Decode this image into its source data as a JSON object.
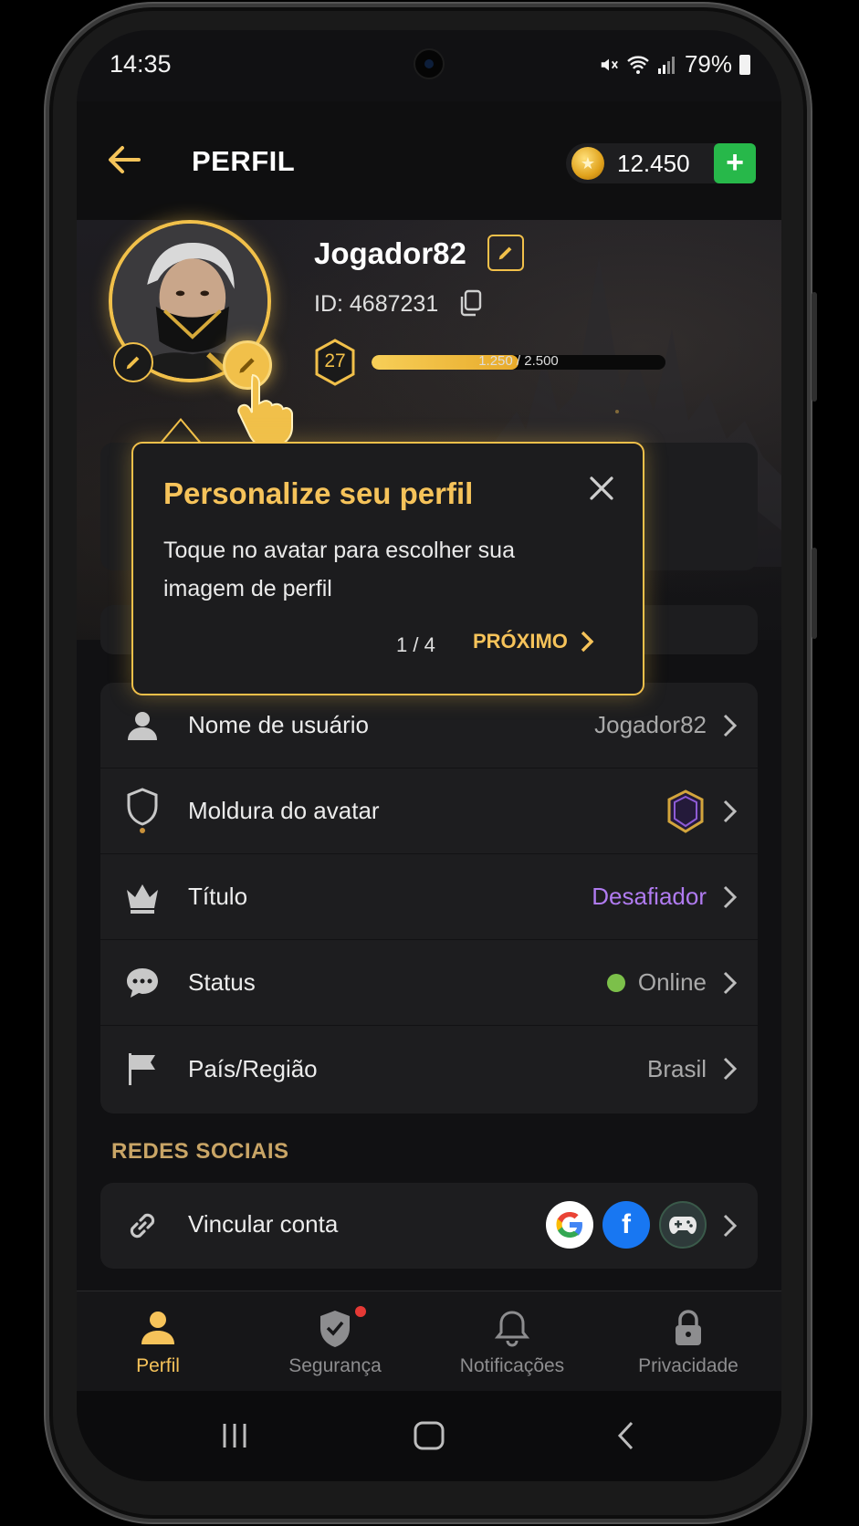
{
  "status_bar": {
    "time": "14:35",
    "battery": "79%"
  },
  "header": {
    "title": "PERFIL",
    "coins": "12.450",
    "add_label": "+"
  },
  "profile": {
    "username": "Jogador82",
    "user_id": "ID: 4687231",
    "level": "27",
    "xp_text": "1.250 / 2.500",
    "xp_progress": 0.5
  },
  "tooltip": {
    "title": "Personalize seu perfil",
    "body": "Toque no avatar para escolher sua imagem de perfil",
    "step": "1 / 4",
    "next_label": "PRÓXIMO"
  },
  "settings": [
    {
      "icon": "user-icon",
      "label": "Nome de usuário",
      "value": "Jogador82"
    },
    {
      "icon": "shield-icon",
      "label": "Moldura do avatar",
      "value": ""
    },
    {
      "icon": "crown-icon",
      "label": "Título",
      "value": "Desafiador",
      "value_color": "#b07bf0"
    },
    {
      "icon": "chat-icon",
      "label": "Status",
      "value": "Online",
      "status_color": "#7cc04a"
    },
    {
      "icon": "flag-icon",
      "label": "País/Região",
      "value": "Brasil"
    }
  ],
  "social": {
    "section_title": "REDES SOCIAIS",
    "link_label": "Vincular conta",
    "providers": [
      "google-icon",
      "facebook-icon",
      "gamepad-icon"
    ]
  },
  "bottom_nav": [
    {
      "label": "Perfil",
      "active": true
    },
    {
      "label": "Segurança",
      "badge": true
    },
    {
      "label": "Notificações"
    },
    {
      "label": "Privacidade"
    }
  ],
  "colors": {
    "accent": "#f1c04a",
    "background": "#111113",
    "card": "#1d1d1f",
    "green": "#27b84a"
  }
}
